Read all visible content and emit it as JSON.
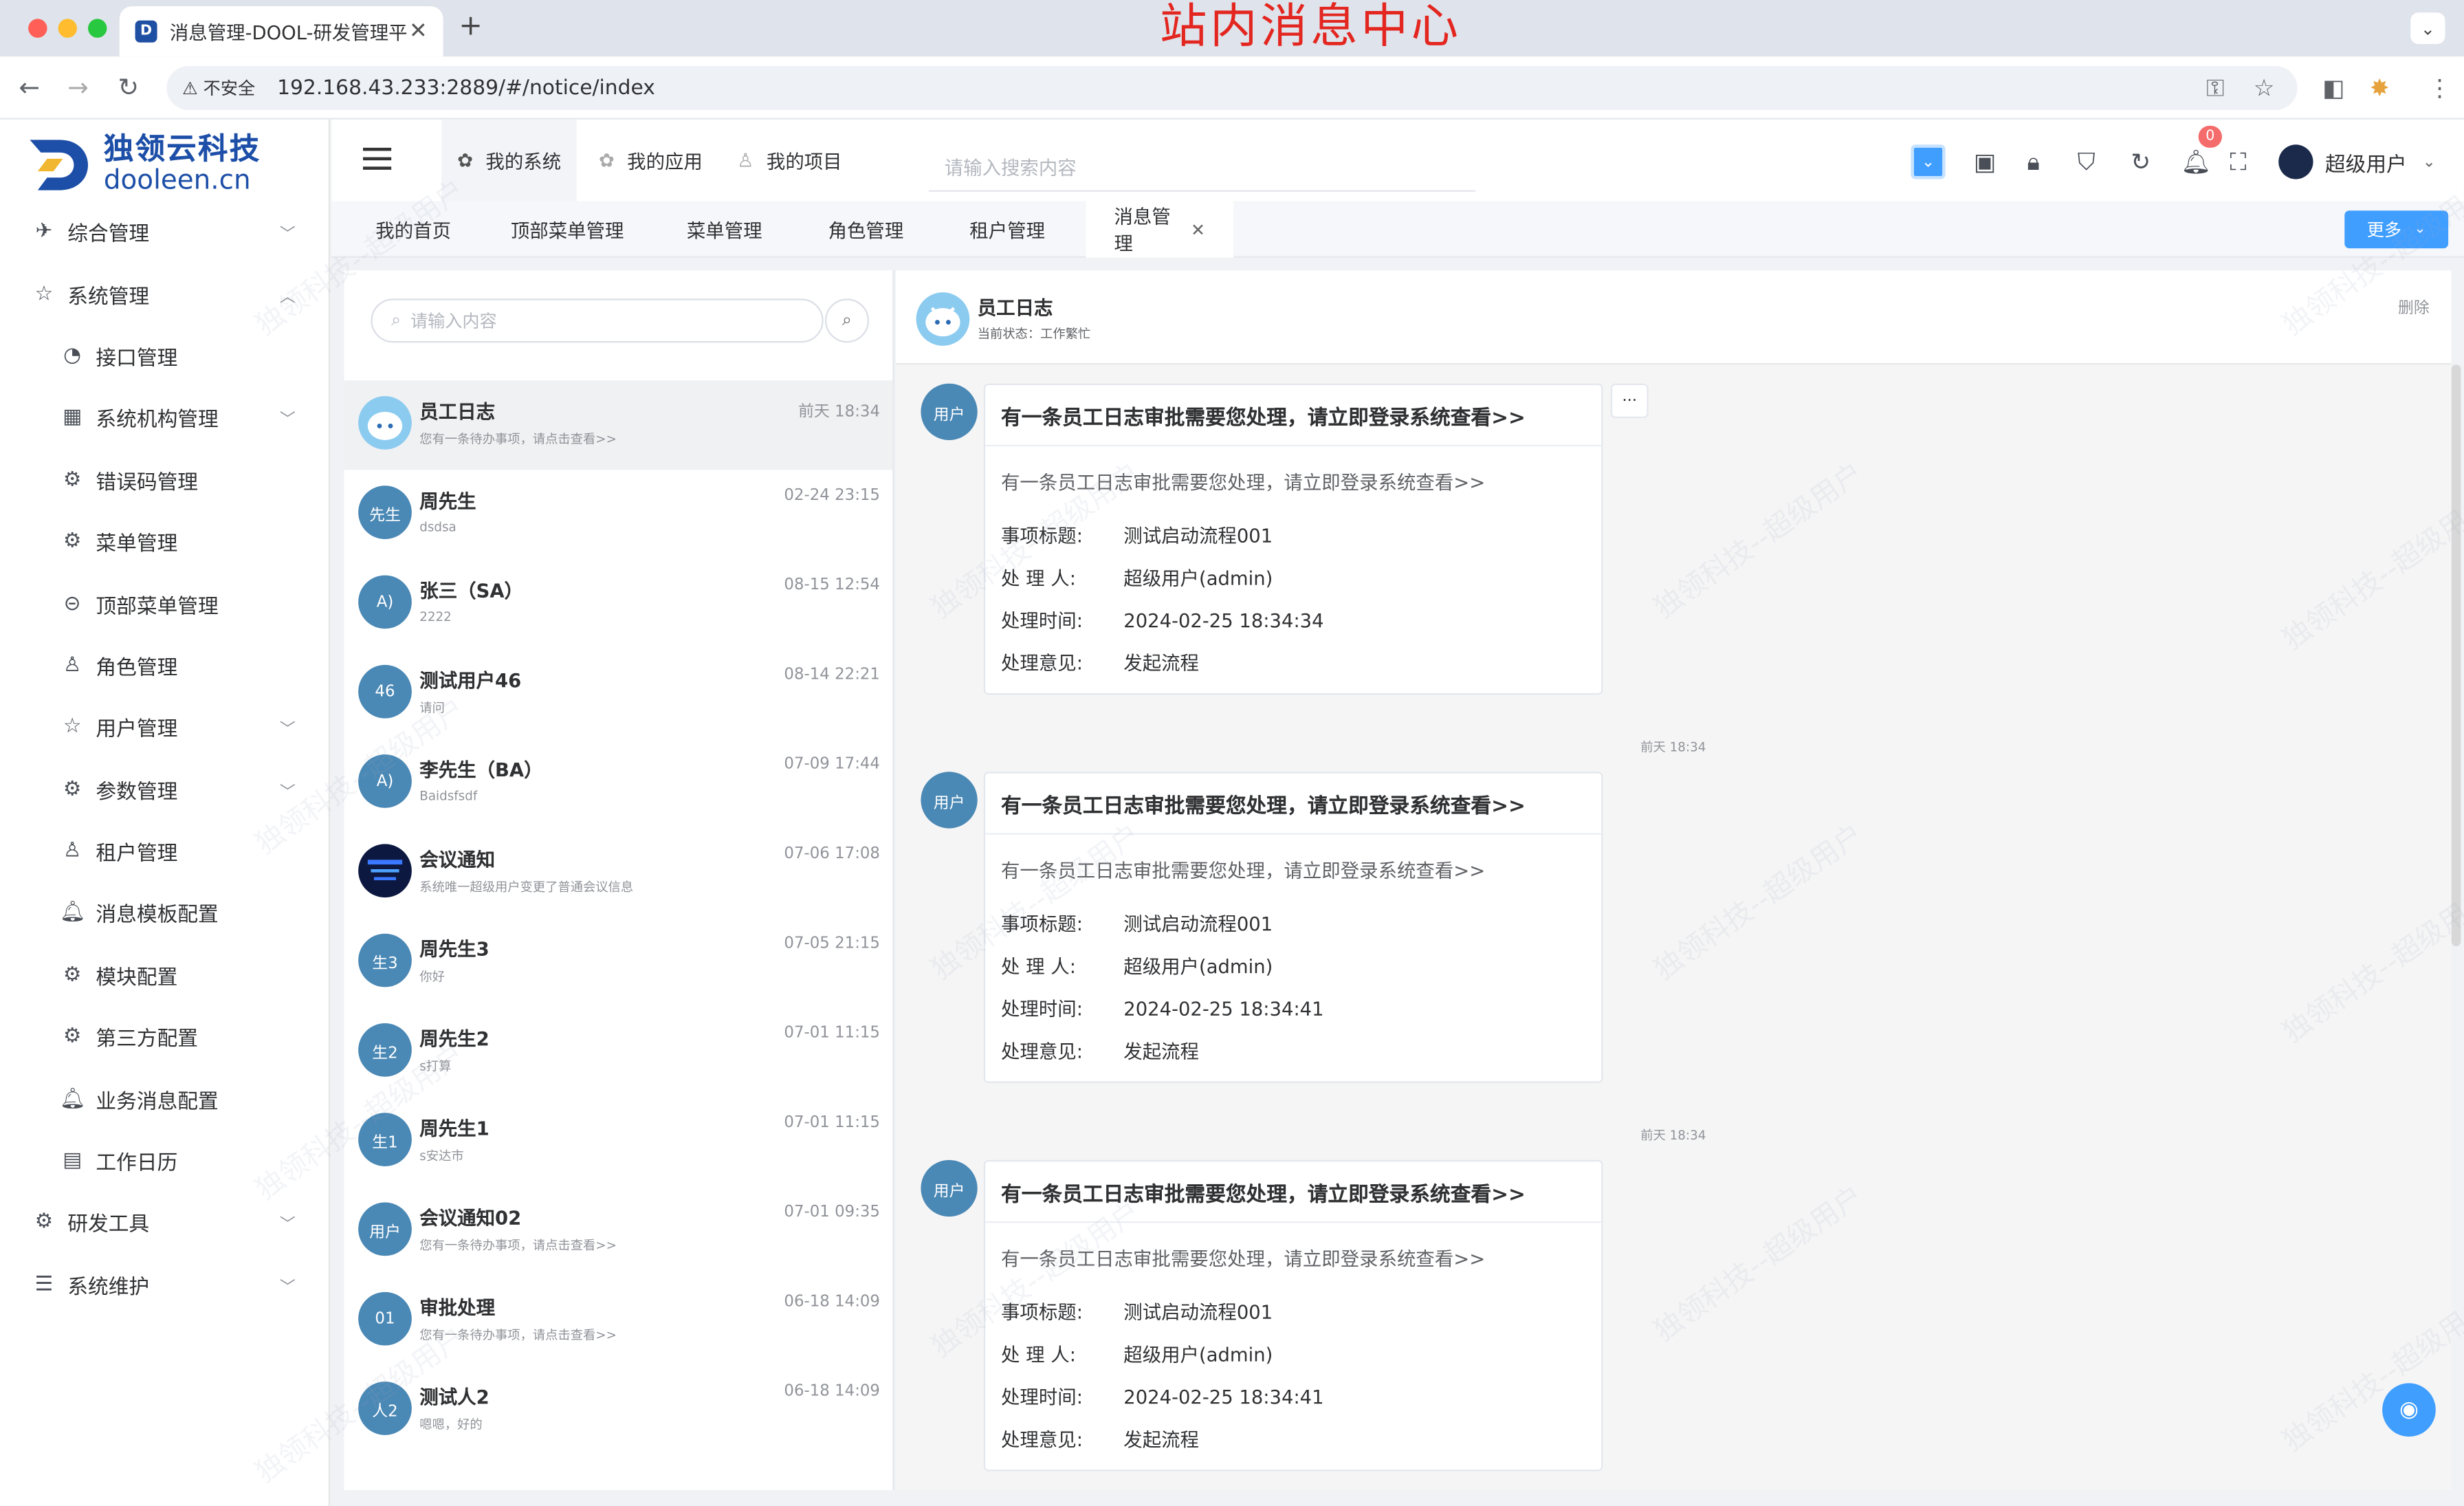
{
  "browser": {
    "tab_title": "消息管理-DOOL-研发管理平台",
    "tab_favicon": "D",
    "new_tab": "+",
    "overlay_title": "站内消息中心",
    "security": "不安全",
    "url": "192.168.43.233:2889/#/notice/index"
  },
  "brand": {
    "name_cn": "独领云科技",
    "name_en": "dooleen.cn",
    "color": "#1d4fa8"
  },
  "sidebar": {
    "items": [
      {
        "label": "综合管理",
        "icon": "send-icon",
        "level": 1,
        "arrow": "chevron-down"
      },
      {
        "label": "系统管理",
        "icon": "star-icon",
        "level": 1,
        "arrow": "chevron-up"
      },
      {
        "label": "接口管理",
        "icon": "gauge-icon",
        "level": 2
      },
      {
        "label": "系统机构管理",
        "icon": "grid-icon",
        "level": 2,
        "arrow": "chevron-down"
      },
      {
        "label": "错误码管理",
        "icon": "gear-icon",
        "level": 2
      },
      {
        "label": "菜单管理",
        "icon": "gear-icon",
        "level": 2
      },
      {
        "label": "顶部菜单管理",
        "icon": "zoom-icon",
        "level": 2
      },
      {
        "label": "角色管理",
        "icon": "user-icon",
        "level": 2
      },
      {
        "label": "用户管理",
        "icon": "star-icon",
        "level": 2,
        "arrow": "chevron-down"
      },
      {
        "label": "参数管理",
        "icon": "gear-icon",
        "level": 2,
        "arrow": "chevron-down"
      },
      {
        "label": "租户管理",
        "icon": "user-icon",
        "level": 2
      },
      {
        "label": "消息模板配置",
        "icon": "bell-icon",
        "level": 2
      },
      {
        "label": "模块配置",
        "icon": "gear-icon",
        "level": 2
      },
      {
        "label": "第三方配置",
        "icon": "gear-icon",
        "level": 2
      },
      {
        "label": "业务消息配置",
        "icon": "bell-icon",
        "level": 2
      },
      {
        "label": "工作日历",
        "icon": "calendar-icon",
        "level": 2
      },
      {
        "label": "研发工具",
        "icon": "gear-icon",
        "level": 1,
        "arrow": "chevron-down"
      },
      {
        "label": "系统维护",
        "icon": "sliders-icon",
        "level": 1,
        "arrow": "chevron-down"
      }
    ]
  },
  "header": {
    "top_tabs": [
      {
        "label": "我的系统",
        "icon": "gear-icon",
        "active": true
      },
      {
        "label": "我的应用",
        "icon": "gear-icon",
        "active": false
      },
      {
        "label": "我的项目",
        "icon": "user-icon",
        "active": false
      }
    ],
    "search_placeholder": "请输入搜索内容",
    "notification_count": "0",
    "user_name": "超级用户"
  },
  "tags": {
    "items": [
      "我的首页",
      "顶部菜单管理",
      "菜单管理",
      "角色管理",
      "租户管理",
      "消息管理"
    ],
    "active": "消息管理",
    "more_label": "更多"
  },
  "contacts": {
    "search_placeholder": "请输入内容",
    "items": [
      {
        "name": "员工日志",
        "avatar": "",
        "message": "您有一条待办事项，请点击查看>>",
        "time": "前天 18:34",
        "selected": true
      },
      {
        "name": "周先生",
        "avatar": "先生",
        "message": "dsdsa",
        "time": "02-24 23:15"
      },
      {
        "name": "张三（SA）",
        "avatar": "A)",
        "message": "2222",
        "time": "08-15 12:54"
      },
      {
        "name": "测试用户46",
        "avatar": "46",
        "message": "请问",
        "time": "08-14 22:21"
      },
      {
        "name": "李先生（BA）",
        "avatar": "A)",
        "message": "Baidsfsdf",
        "time": "07-09 17:44"
      },
      {
        "name": "会议通知",
        "avatar": "",
        "message": "系统唯一超级用户变更了普通会议信息",
        "time": "07-06 17:08"
      },
      {
        "name": "周先生3",
        "avatar": "生3",
        "message": "你好",
        "time": "07-05 21:15"
      },
      {
        "name": "周先生2",
        "avatar": "生2",
        "message": "s打算",
        "time": "07-01 11:15"
      },
      {
        "name": "周先生1",
        "avatar": "生1",
        "message": "s安达市",
        "time": "07-01 11:15"
      },
      {
        "name": "会议通知02",
        "avatar": "用户",
        "message": "您有一条待办事项，请点击查看>>",
        "time": "07-01 09:35"
      },
      {
        "name": "审批处理",
        "avatar": "01",
        "message": "您有一条待办事项，请点击查看>>",
        "time": "06-18 14:09"
      },
      {
        "name": "测试人2",
        "avatar": "人2",
        "message": "嗯嗯，好的",
        "time": "06-18 14:09"
      }
    ]
  },
  "chat": {
    "name": "员工日志",
    "status": "当前状态：工作繁忙",
    "delete_label": "删除",
    "messages": [
      {
        "avatar": "用户",
        "title": "有一条员工日志审批需要您处理，请立即登录系统查看>>",
        "intro": "有一条员工日志审批需要您处理，请立即登录系统查看>>",
        "fields": [
          {
            "k": "事项标题:",
            "v": "测试启动流程001"
          },
          {
            "k": "处 理 人:",
            "v": "超级用户(admin)"
          },
          {
            "k": "处理时间:",
            "v": "2024-02-25 18:34:34"
          },
          {
            "k": "处理意见:",
            "v": "发起流程"
          }
        ],
        "more": "···"
      },
      {
        "avatar": "用户",
        "title": "有一条员工日志审批需要您处理，请立即登录系统查看>>",
        "intro": "有一条员工日志审批需要您处理，请立即登录系统查看>>",
        "timestamp": "前天 18:34",
        "fields": [
          {
            "k": "事项标题:",
            "v": "测试启动流程001"
          },
          {
            "k": "处 理 人:",
            "v": "超级用户(admin)"
          },
          {
            "k": "处理时间:",
            "v": "2024-02-25 18:34:41"
          },
          {
            "k": "处理意见:",
            "v": "发起流程"
          }
        ]
      },
      {
        "avatar": "用户",
        "title": "有一条员工日志审批需要您处理，请立即登录系统查看>>",
        "intro": "有一条员工日志审批需要您处理，请立即登录系统查看>>",
        "timestamp": "前天 18:34",
        "fields": [
          {
            "k": "事项标题:",
            "v": "测试启动流程001"
          },
          {
            "k": "处 理 人:",
            "v": "超级用户(admin)"
          },
          {
            "k": "处理时间:",
            "v": "2024-02-25 18:34:41"
          },
          {
            "k": "处理意见:",
            "v": "发起流程"
          }
        ]
      }
    ]
  },
  "watermark": "独领科技--超级用户",
  "colors": {
    "primary": "#409eff",
    "avatar": "#4a88b5",
    "badge": "#f56c6c",
    "banner": "#e3261f"
  }
}
